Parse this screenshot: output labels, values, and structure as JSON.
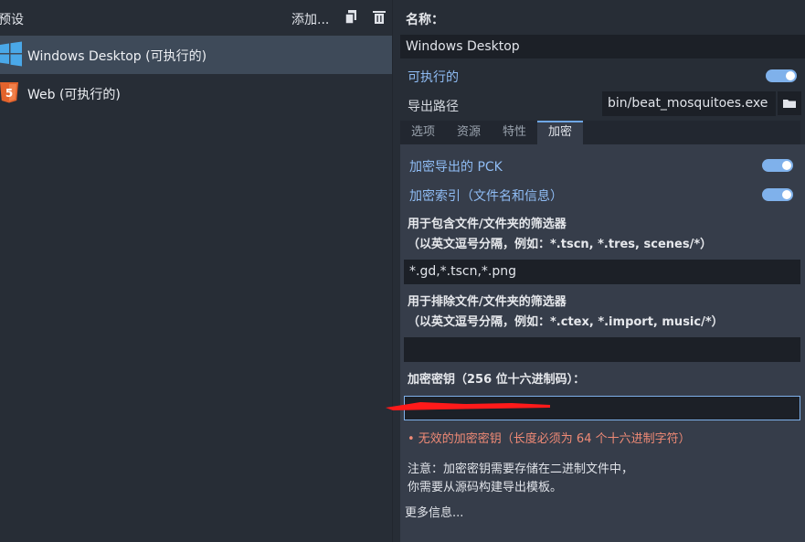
{
  "left": {
    "title": "预设",
    "add_label": "添加...",
    "presets": [
      {
        "label": "Windows Desktop (可执行的)",
        "icon": "windows-icon",
        "selected": true
      },
      {
        "label": "Web (可执行的)",
        "icon": "html5-icon",
        "selected": false
      }
    ]
  },
  "right": {
    "name_label": "名称：",
    "name_value": "Windows Desktop",
    "runnable_label": "可执行的",
    "runnable_on": true,
    "export_path_label": "导出路径",
    "export_path_value": "bin/beat_mosquitoes.exe",
    "tabs": [
      "选项",
      "资源",
      "特性",
      "加密"
    ],
    "active_tab": "加密",
    "encrypt_pck_label": "加密导出的 PCK",
    "encrypt_index_label": "加密索引（文件名和信息）",
    "include_filter_label_1": "用于包含文件/文件夹的筛选器",
    "include_filter_label_2": "（以英文逗号分隔，例如：*.tscn, *.tres, scenes/*）",
    "include_filter_value": "*.gd,*.tscn,*.png",
    "exclude_filter_label_1": "用于排除文件/文件夹的筛选器",
    "exclude_filter_label_2": "（以英文逗号分隔，例如：*.ctex, *.import, music/*）",
    "exclude_filter_value": "",
    "key_label": "加密密钥（256 位十六进制码）：",
    "key_error": "• 无效的加密密钥（长度必须为 64 个十六进制字符）",
    "note_line_1": "注意：加密密钥需要存储在二进制文件中，",
    "note_line_2": "你需要从源码构建导出模板。",
    "more_info": "更多信息..."
  },
  "colors": {
    "accent": "#7fb1eb",
    "error": "#f08a76",
    "background": "#272d36",
    "panel": "#363d4a",
    "redaction": "#ff0000"
  }
}
